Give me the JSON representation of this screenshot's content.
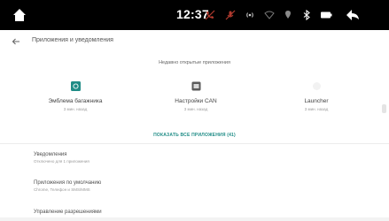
{
  "status_bar": {
    "time": "12:37",
    "icons": [
      "home-icon",
      "call-muted-icon",
      "mic-muted-icon",
      "signal-icon",
      "wifi-icon",
      "location-icon",
      "bluetooth-icon",
      "battery-icon",
      "back-arrow-icon"
    ],
    "background": "#000000",
    "muted_color": "#c0392b"
  },
  "header": {
    "back_icon": "back-arrow-icon",
    "title": "Приложения и уведомления"
  },
  "recent": {
    "title": "Недавно открытые приложения",
    "apps": [
      {
        "name": "Эмблема багажника",
        "sub": "3 мин. назад",
        "icon": "tailgate-emblem-icon",
        "icon_color": "#1f8c86"
      },
      {
        "name": "Настройки CAN",
        "sub": "3 мин. назад",
        "icon": "can-settings-icon",
        "icon_color": "#555555"
      },
      {
        "name": "Launcher",
        "sub": "3 мин. назад",
        "icon": "launcher-icon",
        "icon_color": "#f0f0f0"
      }
    ],
    "show_all": "ПОКАЗАТЬ ВСЕ ПРИЛОЖЕНИЯ (41)",
    "accent": "#1f8c86"
  },
  "settings": [
    {
      "title": "Уведомления",
      "sub": "Отключено для 1 приложения"
    },
    {
      "title": "Приложения по умолчанию",
      "sub": "Chrome, Телефон и SMS/MMS"
    },
    {
      "title": "Управление разрешениями",
      "sub": ""
    }
  ]
}
